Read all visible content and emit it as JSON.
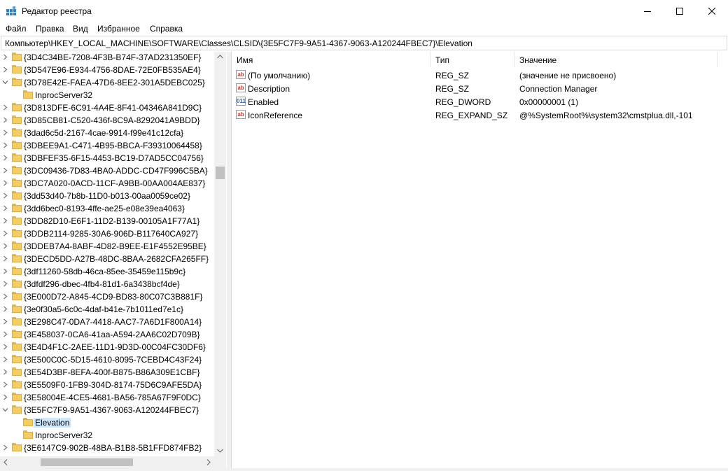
{
  "window": {
    "title": "Редактор реестра",
    "icon": "regedit-icon",
    "controls": [
      "minimize-icon",
      "maximize-icon",
      "close-icon"
    ]
  },
  "menu": [
    "Файл",
    "Правка",
    "Вид",
    "Избранное",
    "Справка"
  ],
  "address": "Компьютер\\HKEY_LOCAL_MACHINE\\SOFTWARE\\Classes\\CLSID\\{3E5FC7F9-9A51-4367-9063-A120244FBEC7}\\Elevation",
  "tree": [
    {
      "label": "{3D4C34BE-7208-4F3B-B74F-37AD231350EF}",
      "level": 0,
      "state": "collapsed"
    },
    {
      "label": "{3D547E96-E934-4756-8DAE-72E0FB535AE4}",
      "level": 0,
      "state": "collapsed"
    },
    {
      "label": "{3D78E42E-FAEA-47D6-8EE2-301A5DEBC025}",
      "level": 0,
      "state": "expanded"
    },
    {
      "label": "InprocServer32",
      "level": 1,
      "state": "none"
    },
    {
      "label": "{3D813DFE-6C91-4A4E-8F41-04346A841D9C}",
      "level": 0,
      "state": "collapsed"
    },
    {
      "label": "{3D85CB81-C520-436f-8C9A-8292041A9BDD}",
      "level": 0,
      "state": "collapsed"
    },
    {
      "label": "{3dad6c5d-2167-4cae-9914-f99e41c12cfa}",
      "level": 0,
      "state": "collapsed"
    },
    {
      "label": "{3DBEE9A1-C471-4B95-BBCA-F39310064458}",
      "level": 0,
      "state": "collapsed"
    },
    {
      "label": "{3DBFEF35-6F15-4453-BC19-D7AD5CC04756}",
      "level": 0,
      "state": "collapsed"
    },
    {
      "label": "{3DC09436-7D83-4BA0-ADDC-CD47F996C5BA}",
      "level": 0,
      "state": "collapsed"
    },
    {
      "label": "{3DC7A020-0ACD-11CF-A9BB-00AA004AE837}",
      "level": 0,
      "state": "collapsed"
    },
    {
      "label": "{3dd53d40-7b8b-11D0-b013-00aa0059ce02}",
      "level": 0,
      "state": "collapsed"
    },
    {
      "label": "{3dd6bec0-8193-4ffe-ae25-e08e39ea4063}",
      "level": 0,
      "state": "collapsed"
    },
    {
      "label": "{3DD82D10-E6F1-11D2-B139-00105A1F77A1}",
      "level": 0,
      "state": "collapsed"
    },
    {
      "label": "{3DDB2114-9285-30A6-906D-B117640CA927}",
      "level": 0,
      "state": "collapsed"
    },
    {
      "label": "{3DDEB7A4-8ABF-4D82-B9EE-E1F4552E95BE}",
      "level": 0,
      "state": "collapsed"
    },
    {
      "label": "{3DECD5DD-A27B-48DC-8BAA-2682CFA265FF}",
      "level": 0,
      "state": "collapsed"
    },
    {
      "label": "{3df11260-58db-46ca-85ee-35459e115b9c}",
      "level": 0,
      "state": "collapsed"
    },
    {
      "label": "{3dfdf296-dbec-4fb4-81d1-6a3438bcf4de}",
      "level": 0,
      "state": "collapsed"
    },
    {
      "label": "{3E000D72-A845-4CD9-BD83-80C07C3B881F}",
      "level": 0,
      "state": "collapsed"
    },
    {
      "label": "{3e0f30a5-6c0c-4daf-b41e-7b1011ed7e1c}",
      "level": 0,
      "state": "collapsed"
    },
    {
      "label": "{3E298C47-0DA7-4418-AAC7-7A6D1F800A14}",
      "level": 0,
      "state": "collapsed"
    },
    {
      "label": "{3E458037-0CA6-41aa-A594-2AA6C02D709B}",
      "level": 0,
      "state": "collapsed"
    },
    {
      "label": "{3E4D4F1C-2AEE-11D1-9D3D-00C04FC30DF6}",
      "level": 0,
      "state": "collapsed"
    },
    {
      "label": "{3E500C0C-5D15-4610-8095-7CEBD4C43F24}",
      "level": 0,
      "state": "collapsed"
    },
    {
      "label": "{3E54D3BF-8EFA-400f-B875-B86A309E1CBF}",
      "level": 0,
      "state": "collapsed"
    },
    {
      "label": "{3E5509F0-1FB9-304D-8174-75D6C9AFE5DA}",
      "level": 0,
      "state": "collapsed"
    },
    {
      "label": "{3E58004E-4CE5-4681-BA56-785A67F9F0DC}",
      "level": 0,
      "state": "collapsed"
    },
    {
      "label": "{3E5FC7F9-9A51-4367-9063-A120244FBEC7}",
      "level": 0,
      "state": "expanded"
    },
    {
      "label": "Elevation",
      "level": 1,
      "state": "none",
      "selected": true
    },
    {
      "label": "InprocServer32",
      "level": 1,
      "state": "none"
    },
    {
      "label": "{3E6147C9-902B-48BA-B1B8-5B1FFD874FB2}",
      "level": 0,
      "state": "collapsed"
    }
  ],
  "columns": [
    "Имя",
    "Тип",
    "Значение"
  ],
  "values": [
    {
      "icon": "string-value-icon",
      "glyph": "ab",
      "name": "(По умолчанию)",
      "type": "REG_SZ",
      "data": "(значение не присвоено)"
    },
    {
      "icon": "string-value-icon",
      "glyph": "ab",
      "name": "Description",
      "type": "REG_SZ",
      "data": "Connection Manager"
    },
    {
      "icon": "dword-value-icon",
      "glyph": "011",
      "name": "Enabled",
      "type": "REG_DWORD",
      "data": "0x00000001 (1)"
    },
    {
      "icon": "string-value-icon",
      "glyph": "ab",
      "name": "IconReference",
      "type": "REG_EXPAND_SZ",
      "data": "@%SystemRoot%\\system32\\cmstplua.dll,-101"
    }
  ],
  "colors": {
    "selection": "#cce8ff",
    "folder": "#f3cd5f",
    "string_icon": "#c0392b",
    "dword_icon": "#1f5fbf"
  }
}
